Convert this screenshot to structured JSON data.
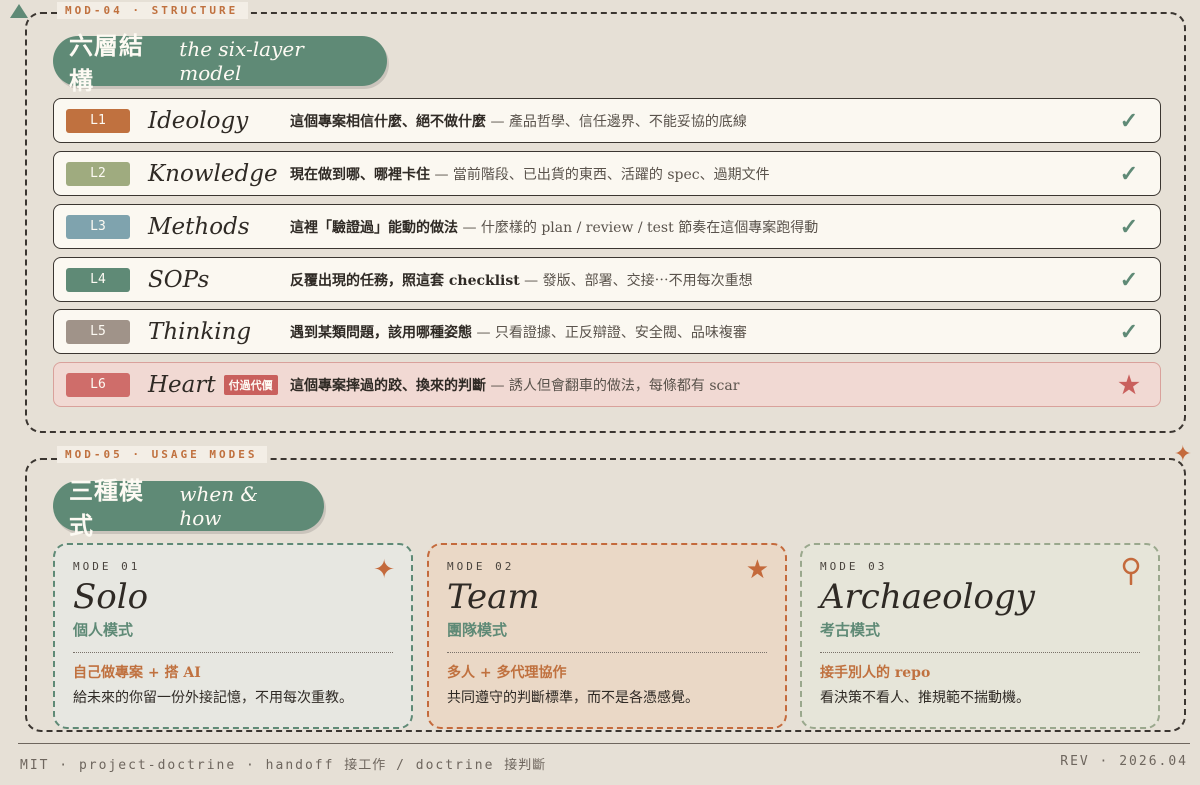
{
  "structure": {
    "tab_label": "MOD-04 · STRUCTURE",
    "title_cjk": "六層結構",
    "title_en": "the six-layer model",
    "layers": [
      {
        "badge": "L1",
        "color": "#c0713f",
        "name": "Ideology",
        "desc_bold": "這個專案相信什麼、絕不做什麼",
        "desc_rest": " — 產品哲學、信任邊界、不能妥協的底線",
        "status": "✓"
      },
      {
        "badge": "L2",
        "color": "#9fab7f",
        "name": "Knowledge",
        "desc_bold": "現在做到哪、哪裡卡住",
        "desc_rest": " — 當前階段、已出貨的東西、活躍的 spec、過期文件",
        "status": "✓"
      },
      {
        "badge": "L3",
        "color": "#7fa3ae",
        "name": "Methods",
        "desc_bold": "這裡「驗證過」能動的做法",
        "desc_rest": " — 什麼樣的 plan / review / test 節奏在這個專案跑得動",
        "status": "✓"
      },
      {
        "badge": "L4",
        "color": "#5f8a76",
        "name": "SOPs",
        "desc_bold": "反覆出現的任務，照這套 checklist",
        "desc_rest": " — 發版、部署、交接⋯不用每次重想",
        "status": "✓"
      },
      {
        "badge": "L5",
        "color": "#a09389",
        "name": "Thinking",
        "desc_bold": "遇到某類問題，該用哪種姿態",
        "desc_rest": " — 只看證據、正反辯證、安全閥、品味複審",
        "status": "✓"
      },
      {
        "badge": "L6",
        "color": "#cf6d6a",
        "name": "Heart",
        "tag": "付過代價",
        "desc_bold": "這個專案摔過的跤、換來的判斷",
        "desc_rest": " — 誘人但會翻車的做法，每條都有 scar",
        "status": "★"
      }
    ]
  },
  "usage": {
    "tab_label": "MOD-05 · USAGE MODES",
    "title_cjk": "三種模式",
    "title_en": "when & how",
    "modes": [
      {
        "mode": "MODE 01",
        "title": "Solo",
        "subtitle": "個人模式",
        "lead": "自己做專案 + 搭 AI",
        "text": "給未來的你留一份外接記憶，不用每次重教。",
        "icon": "✦",
        "icon_name": "sparkle-icon"
      },
      {
        "mode": "MODE 02",
        "title": "Team",
        "subtitle": "團隊模式",
        "lead": "多人 + 多代理協作",
        "text": "共同遵守的判斷標準，而不是各憑感覺。",
        "icon": "★",
        "icon_name": "star-icon"
      },
      {
        "mode": "MODE 03",
        "title": "Archaeology",
        "subtitle": "考古模式",
        "lead": "接手別人的 repo",
        "text": "看決策不看人、推規範不揣動機。",
        "icon_name": "magnifier-icon"
      }
    ]
  },
  "footer": {
    "left_a": "MIT · project-doctrine · handoff ",
    "left_b": "接工作",
    "left_c": " / doctrine ",
    "left_d": "接判斷",
    "right": "REV · 2026.04"
  },
  "colors": {
    "accent_green": "#5f8a76",
    "accent_orange": "#c0713f",
    "heart_red": "#cf6d6a"
  }
}
